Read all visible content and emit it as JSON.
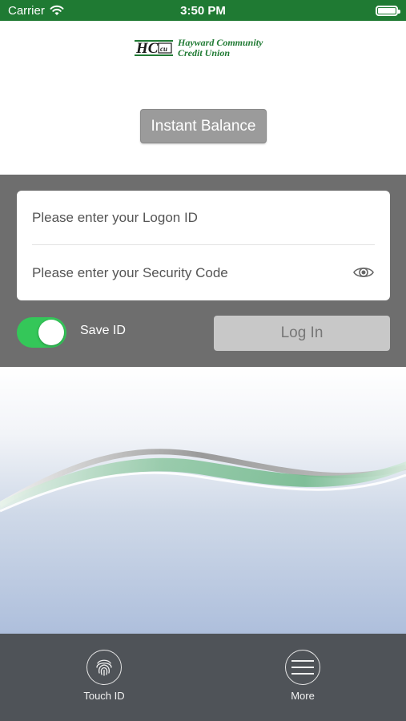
{
  "status_bar": {
    "carrier": "Carrier",
    "time": "3:50 PM"
  },
  "logo": {
    "mark": "HCCU",
    "line1": "Hayward Community",
    "line2": "Credit Union"
  },
  "instant_balance": {
    "label": "Instant Balance"
  },
  "login": {
    "logon_placeholder": "Please enter your Logon ID",
    "security_placeholder": "Please enter your Security Code",
    "save_id_label": "Save ID",
    "save_id_on": true,
    "login_label": "Log In"
  },
  "tabs": [
    {
      "label": "Touch ID",
      "icon": "fingerprint-icon"
    },
    {
      "label": "More",
      "icon": "menu-icon"
    }
  ],
  "colors": {
    "status_bar": "#1f7a33",
    "brand_green": "#1f7a33",
    "toggle_on": "#34c759",
    "panel": "#6e6e6e",
    "tab_bar": "#4f5358"
  }
}
